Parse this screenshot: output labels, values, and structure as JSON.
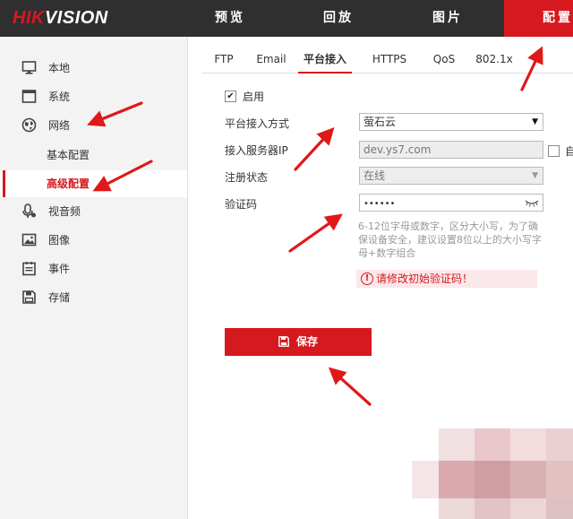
{
  "header": {
    "logo_red": "HIK",
    "logo_white": "VISION",
    "nav": [
      "预览",
      "回放",
      "图片",
      "配置"
    ]
  },
  "sidebar": {
    "items": [
      {
        "label": "本地",
        "icon": "monitor-icon"
      },
      {
        "label": "系统",
        "icon": "system-window-icon"
      },
      {
        "label": "网络",
        "icon": "globe-icon"
      },
      {
        "label": "视音频",
        "icon": "microphone-icon"
      },
      {
        "label": "图像",
        "icon": "image-icon"
      },
      {
        "label": "事件",
        "icon": "event-list-icon"
      },
      {
        "label": "存储",
        "icon": "disk-icon"
      }
    ],
    "network_sub": [
      "基本配置",
      "高级配置"
    ],
    "active_sub": "高级配置"
  },
  "tabs": [
    "FTP",
    "Email",
    "平台接入",
    "HTTPS",
    "QoS",
    "802.1x"
  ],
  "active_tab": "平台接入",
  "form": {
    "enable_label": "启用",
    "enable_checked": true,
    "mode_label": "平台接入方式",
    "mode_value": "萤石云",
    "server_label": "接入服务器IP",
    "server_value": "dev.ys7.com",
    "custom_label": "自",
    "status_label": "注册状态",
    "status_value": "在线",
    "code_label": "验证码",
    "code_value": "••••••",
    "hint": "6-12位字母或数字，区分大小写，为了确保设备安全，建议设置8位以上的大小写字母+数字组合",
    "warning_icon": "!",
    "warning": "请修改初始验证码！",
    "save_label": "保存"
  },
  "colors": {
    "accent": "#d6181f",
    "topbar": "#2f2f2f",
    "sidebar": "#f3f3f3"
  }
}
